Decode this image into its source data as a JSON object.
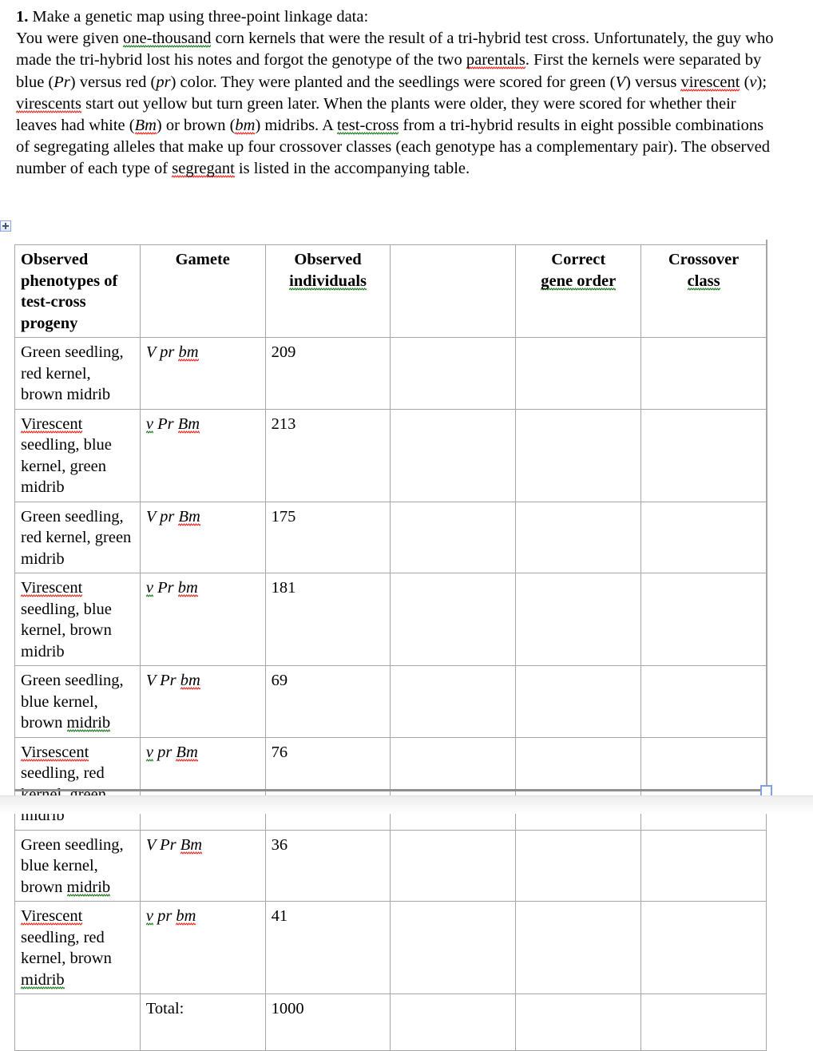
{
  "question": {
    "number": "1.",
    "title": "Make a genetic map using three-point linkage data:",
    "body_runs": [
      {
        "t": "You were given "
      },
      {
        "t": "one-thousand",
        "sq": "green"
      },
      {
        "t": " corn kernels that were the result of a tri-hybrid test cross. Unfortunately, the guy who made the tri-hybrid lost his notes and forgot the genotype of the two "
      },
      {
        "t": "parentals",
        "sq": "red"
      },
      {
        "t": ". First the kernels were separated by blue ("
      },
      {
        "t": "Pr",
        "i": true
      },
      {
        "t": ") versus red ("
      },
      {
        "t": "pr",
        "i": true
      },
      {
        "t": ") color. They were planted and the seedlings were scored for green ("
      },
      {
        "t": "V",
        "i": true
      },
      {
        "t": ") versus "
      },
      {
        "t": "virescent",
        "sq": "red"
      },
      {
        "t": " ("
      },
      {
        "t": "v",
        "i": true
      },
      {
        "t": "); "
      },
      {
        "t": "virescents",
        "sq": "red"
      },
      {
        "t": " start out yellow but turn green later. When the plants were older, they were scored for whether their leaves had white ("
      },
      {
        "t": "Bm",
        "i": true,
        "sq": "red"
      },
      {
        "t": ") or brown ("
      },
      {
        "t": "bm",
        "i": true,
        "sq": "red"
      },
      {
        "t": ") midribs.  A "
      },
      {
        "t": "test-cross",
        "sq": "green"
      },
      {
        "t": " from a tri-hybrid results in eight possible combinations of segregating alleles that make up four crossover classes (each genotype has a complementary pair). The observed number of each type of "
      },
      {
        "t": "segregant",
        "sq": "red"
      },
      {
        "t": " is listed in the accompanying table."
      }
    ]
  },
  "table": {
    "headers": {
      "phenotypes": "Observed phenotypes of test-cross progeny",
      "gamete": "Gamete",
      "observed_line1": "Observed",
      "observed_line2": "individuals",
      "gap": "",
      "gene_order_line1": "Correct",
      "gene_order_line2": "gene order",
      "crossover_line1": "Crossover",
      "crossover_line2": "class"
    },
    "rows": [
      {
        "phenotype_runs": [
          {
            "t": "Green seedling, red kernel, brown midrib"
          }
        ],
        "gamete_runs": [
          {
            "t": "V pr "
          },
          {
            "t": "bm",
            "sq": "red"
          }
        ],
        "observed": "209",
        "gene_order": "",
        "crossover_class": ""
      },
      {
        "phenotype_runs": [
          {
            "t": "Virescent",
            "sq": "red"
          },
          {
            "t": " seedling, blue kernel, green midrib"
          }
        ],
        "gamete_runs": [
          {
            "t": "v",
            "sq": "green"
          },
          {
            "t": " Pr "
          },
          {
            "t": "Bm",
            "sq": "red"
          }
        ],
        "observed": "213",
        "gene_order": "",
        "crossover_class": ""
      },
      {
        "phenotype_runs": [
          {
            "t": "Green seedling, red kernel, green midrib"
          }
        ],
        "gamete_runs": [
          {
            "t": "V pr "
          },
          {
            "t": "Bm",
            "sq": "red"
          }
        ],
        "observed": "175",
        "gene_order": "",
        "crossover_class": ""
      },
      {
        "phenotype_runs": [
          {
            "t": "Virescent",
            "sq": "red"
          },
          {
            "t": " seedling, blue kernel, brown midrib"
          }
        ],
        "gamete_runs": [
          {
            "t": "v",
            "sq": "green"
          },
          {
            "t": " Pr "
          },
          {
            "t": "bm",
            "sq": "red"
          }
        ],
        "observed": "181",
        "gene_order": "",
        "crossover_class": ""
      },
      {
        "phenotype_runs": [
          {
            "t": "Green seedling, blue kernel, brown "
          },
          {
            "t": "midrib",
            "sq": "green"
          }
        ],
        "gamete_runs": [
          {
            "t": "V Pr "
          },
          {
            "t": "bm",
            "sq": "red"
          }
        ],
        "observed": "69",
        "gene_order": "",
        "crossover_class": ""
      },
      {
        "phenotype_runs": [
          {
            "t": "Virsescent",
            "sq": "red"
          },
          {
            "t": " seedling, red kernel, green midrib"
          }
        ],
        "gamete_runs": [
          {
            "t": "v",
            "sq": "green"
          },
          {
            "t": " pr "
          },
          {
            "t": "Bm",
            "sq": "red"
          }
        ],
        "observed": "76",
        "gene_order": "",
        "crossover_class": ""
      },
      {
        "phenotype_runs": [
          {
            "t": "Green seedling, blue kernel, brown "
          },
          {
            "t": "midrib",
            "sq": "green"
          }
        ],
        "gamete_runs": [
          {
            "t": "V Pr "
          },
          {
            "t": "Bm",
            "sq": "red"
          }
        ],
        "observed": "36",
        "gene_order": "",
        "crossover_class": ""
      },
      {
        "phenotype_runs": [
          {
            "t": "Virescent",
            "sq": "red"
          },
          {
            "t": " seedling, red kernel, brown "
          },
          {
            "t": "midrib",
            "sq": "green"
          }
        ],
        "gamete_runs": [
          {
            "t": "v",
            "sq": "green"
          },
          {
            "t": " pr "
          },
          {
            "t": "bm",
            "sq": "red"
          }
        ],
        "observed": "41",
        "gene_order": "",
        "crossover_class": ""
      }
    ],
    "total_row": {
      "phenotype": "",
      "label": "Total:",
      "observed": "1000",
      "gene_order": "",
      "crossover_class": ""
    }
  },
  "colors": {
    "spell_error": "#e8251c",
    "grammar_error": "#1b7a1b",
    "table_border": "#a6a6a6",
    "handle_accent": "#7da0e8"
  }
}
